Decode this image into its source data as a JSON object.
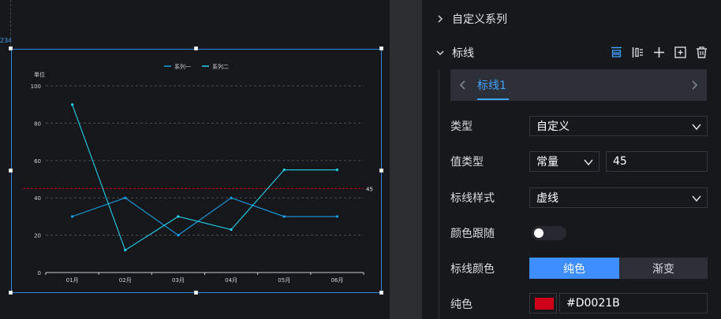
{
  "canvas": {
    "ruler_marker": "234",
    "chart": {
      "unit_label": "单位",
      "markline_value_label": "45"
    }
  },
  "chart_data": {
    "type": "line",
    "categories": [
      "01月",
      "02月",
      "03月",
      "04月",
      "05月",
      "06月"
    ],
    "series": [
      {
        "name": "系列一",
        "color": "#1aa0e8",
        "values": [
          30,
          40,
          20,
          40,
          30,
          30
        ]
      },
      {
        "name": "系列二",
        "color": "#22d3ee",
        "values": [
          90,
          12,
          30,
          23,
          55,
          55
        ]
      }
    ],
    "ylim": [
      0,
      100
    ],
    "yticks": [
      0,
      20,
      40,
      60,
      80,
      100
    ],
    "ylabel": "单位",
    "markline": {
      "value": 45,
      "color": "#D0021B",
      "style": "dashed"
    },
    "grid": true,
    "legend_position": "top-center"
  },
  "panel": {
    "custom_series": {
      "title": "自定义系列"
    },
    "markline": {
      "title": "标线",
      "tools": [
        "align-top-icon",
        "align-left-icon",
        "add-icon",
        "copy-icon",
        "trash-icon"
      ],
      "tab": {
        "label": "标线1"
      },
      "type": {
        "label": "类型",
        "value": "自定义"
      },
      "value_type": {
        "label": "值类型",
        "select": "常量",
        "input": "45"
      },
      "line_style": {
        "label": "标线样式",
        "value": "虚线"
      },
      "color_follow": {
        "label": "颜色跟随",
        "on": false
      },
      "line_color": {
        "label": "标线颜色",
        "options": [
          "纯色",
          "渐变"
        ],
        "selected": "纯色"
      },
      "solid": {
        "label": "纯色",
        "value": "#D0021B",
        "swatch": "#D0021B"
      }
    }
  }
}
